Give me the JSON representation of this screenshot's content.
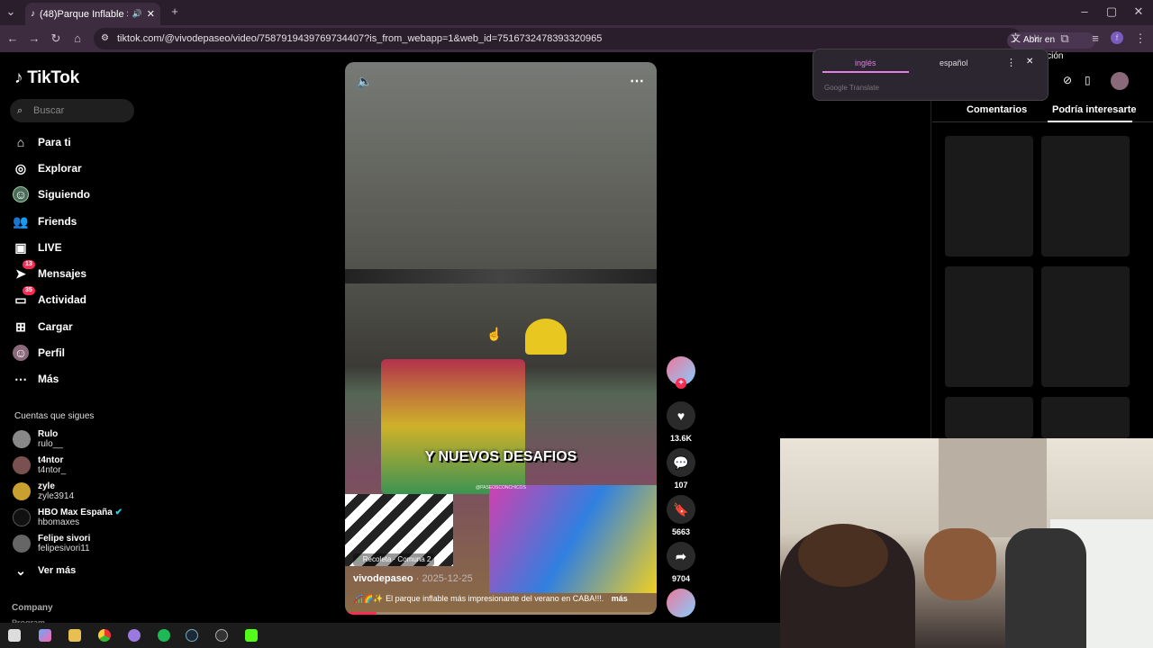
{
  "browser": {
    "tab_title": "(48)Parque Inflable Super Jue",
    "url": "tiktok.com/@vivodepaseo/video/7587919439769734407?is_from_webapp=1&web_id=7516732478393320965",
    "open_app_label": "Abrir en aplicación"
  },
  "translate": {
    "lang_active": "inglés",
    "lang_other": "español",
    "provider": "Google Translate"
  },
  "sidebar": {
    "logo": "TikTok",
    "search_placeholder": "Buscar",
    "nav": [
      {
        "label": "Para ti",
        "icon": "home-icon"
      },
      {
        "label": "Explorar",
        "icon": "compass-icon"
      },
      {
        "label": "Siguiendo",
        "icon": "following-icon"
      },
      {
        "label": "Friends",
        "icon": "friends-icon"
      },
      {
        "label": "LIVE",
        "icon": "live-icon"
      },
      {
        "label": "Mensajes",
        "icon": "messages-icon",
        "badge": "13"
      },
      {
        "label": "Actividad",
        "icon": "activity-icon",
        "badge": "35"
      },
      {
        "label": "Cargar",
        "icon": "upload-icon"
      },
      {
        "label": "Perfil",
        "icon": "profile-icon"
      },
      {
        "label": "Más",
        "icon": "more-icon"
      }
    ],
    "following_title": "Cuentas que sigues",
    "accounts": [
      {
        "name": "Rulo",
        "handle": "rulo__"
      },
      {
        "name": "t4ntor",
        "handle": "t4ntor_"
      },
      {
        "name": "zyle",
        "handle": "zyle3914"
      },
      {
        "name": "HBO Max España",
        "handle": "hbomaxes"
      },
      {
        "name": "Felipe sivori",
        "handle": "felipesivori11"
      }
    ],
    "see_more": "Ver más",
    "company": "Company",
    "program": "Program"
  },
  "video": {
    "overlay_text": "Y NUEVOS DESAFIOS",
    "watermark": "@PASEOSCONCHICOS",
    "location": "Recoleta · Comuna 2",
    "username": "vivodepaseo",
    "date": "2025-12-25",
    "description": "El parque inflable más impresionante del verano en CABA!!!.",
    "more": "más"
  },
  "actions": {
    "likes": "13.6K",
    "comments": "107",
    "saves": "5663",
    "shares": "9704"
  },
  "right_panel": {
    "tab_comments": "Comentarios",
    "tab_interest": "Podría interesarte"
  }
}
